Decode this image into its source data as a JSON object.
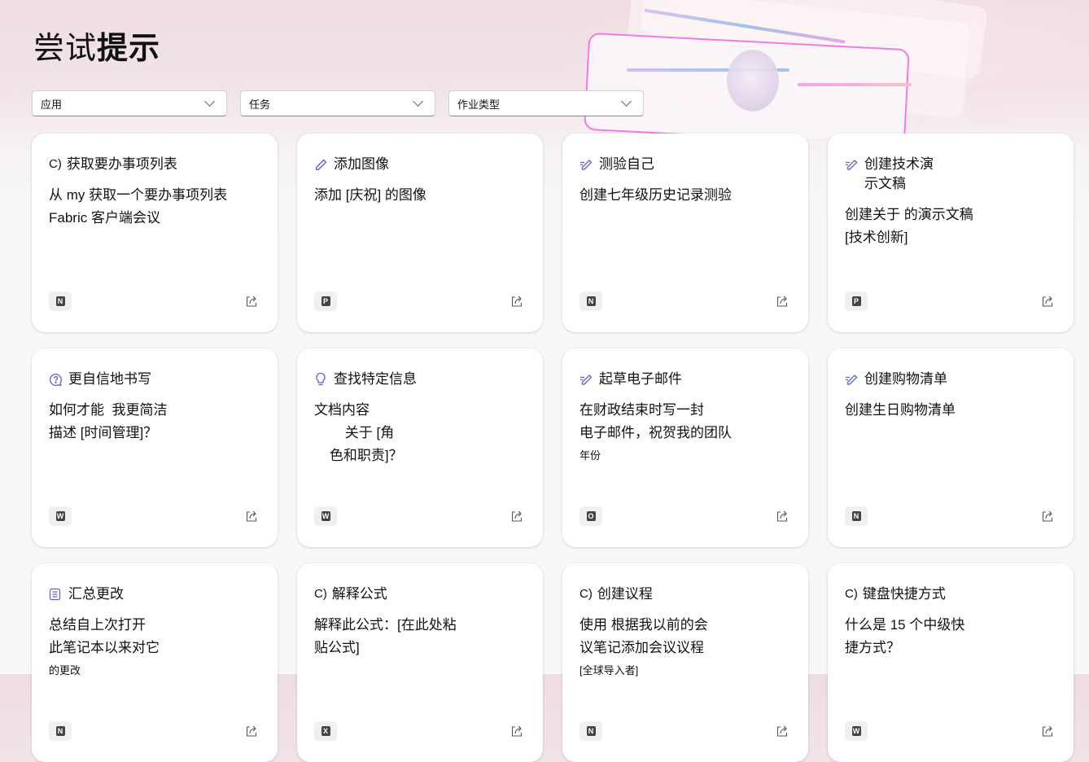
{
  "page": {
    "title_light": "尝试",
    "title_bold": "提示"
  },
  "filters": [
    {
      "label": "应用"
    },
    {
      "label": "任务"
    },
    {
      "label": "作业类型"
    }
  ],
  "cards": [
    {
      "icon": "c-text",
      "icon_text": "C)",
      "title": [
        "获取要办事项列表"
      ],
      "desc": [
        "从 my 获取一个要办事项列表",
        "Fabric 客户端会议"
      ],
      "app": "onenote",
      "app_letter": "N"
    },
    {
      "icon": "pencil",
      "title": [
        "添加图像"
      ],
      "desc": [
        "添加 [庆祝] 的图像"
      ],
      "app": "powerpoint",
      "app_letter": "P"
    },
    {
      "icon": "pen-sparkle",
      "title": [
        "测验自己"
      ],
      "desc": [
        "创建七年级历史记录测验"
      ],
      "app": "onenote",
      "app_letter": "N"
    },
    {
      "icon": "pen-sparkle",
      "title": [
        "创建技术演",
        "示文稿"
      ],
      "desc": [
        "创建关于 的演示文稿",
        "[技术创新]"
      ],
      "app": "powerpoint",
      "app_letter": "P"
    },
    {
      "icon": "question-chat",
      "title": [
        "更自信地书写"
      ],
      "desc": [
        "如何才能  我更简洁",
        "描述 [时间管理]？"
      ],
      "app": "word",
      "app_letter": "W"
    },
    {
      "icon": "lightbulb",
      "title": [
        "查找特定信息"
      ],
      "desc": [
        "文档内容",
        "        关于 [角",
        "    色和职责]？"
      ],
      "app": "word",
      "app_letter": "W"
    },
    {
      "icon": "pen-sparkle",
      "title": [
        "起草电子邮件"
      ],
      "desc": [
        "在财政结束时写一封",
        "电子邮件，祝贺我的团队"
      ],
      "desc_small": "年份",
      "app": "outlook",
      "app_letter": "O"
    },
    {
      "icon": "pen-sparkle",
      "title": [
        "创建购物清单"
      ],
      "desc": [
        "创建生日购物清单"
      ],
      "app": "onenote",
      "app_letter": "N"
    },
    {
      "icon": "list",
      "title": [
        "汇总更改"
      ],
      "desc": [
        "总结自上次打开",
        "此笔记本以来对它"
      ],
      "desc_small": "的更改",
      "app": "onenote",
      "app_letter": "N"
    },
    {
      "icon": "c-text",
      "icon_text": "C)",
      "title": [
        "解释公式"
      ],
      "desc": [
        "解释此公式：[在此处粘",
        "贴公式]"
      ],
      "app": "excel",
      "app_letter": "X"
    },
    {
      "icon": "c-text",
      "icon_text": "C)",
      "title": [
        "创建议程"
      ],
      "desc": [
        "使用 根据我以前的会",
        "议笔记添加会议议程"
      ],
      "desc_small": "[全球导入者]",
      "app": "onenote",
      "app_letter": "N"
    },
    {
      "icon": "c-text",
      "icon_text": "C)",
      "title": [
        "键盘快捷方式"
      ],
      "desc": [
        "什么是 15 个中级快",
        "捷方式？"
      ],
      "app": "word",
      "app_letter": "W"
    }
  ],
  "colors": {
    "accent": "#5b5fc7",
    "plate_pink": "#f37ae5"
  }
}
